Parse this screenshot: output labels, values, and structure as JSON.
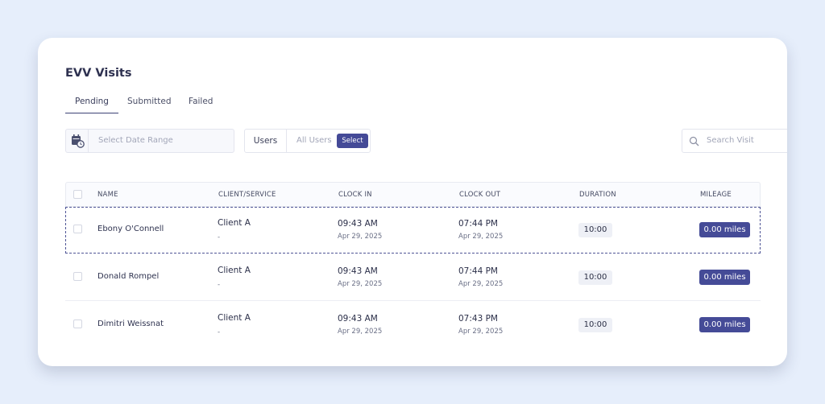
{
  "page": {
    "title": "EVV Visits"
  },
  "tabs": [
    {
      "label": "Pending",
      "active": true
    },
    {
      "label": "Submitted",
      "active": false
    },
    {
      "label": "Failed",
      "active": false
    }
  ],
  "filters": {
    "date_icon": "calendar-clock-icon",
    "date_placeholder": "Select Date Range",
    "users_label": "Users",
    "users_value": "All Users",
    "select_label": "Select",
    "search_icon": "search-icon",
    "search_placeholder": "Search Visit"
  },
  "table": {
    "columns": [
      "NAME",
      "CLIENT/SERVICE",
      "CLOCK IN",
      "CLOCK OUT",
      "DURATION",
      "MILEAGE"
    ],
    "rows": [
      {
        "name": "Ebony O'Connell",
        "client": "Client A",
        "service": "-",
        "clock_in_time": "09:43 AM",
        "clock_in_date": "Apr 29, 2025",
        "clock_out_time": "07:44 PM",
        "clock_out_date": "Apr 29, 2025",
        "duration": "10:00",
        "mileage": "0.00 miles"
      },
      {
        "name": "Donald Rompel",
        "client": "Client A",
        "service": "-",
        "clock_in_time": "09:43 AM",
        "clock_in_date": "Apr 29, 2025",
        "clock_out_time": "07:44 PM",
        "clock_out_date": "Apr 29, 2025",
        "duration": "10:00",
        "mileage": "0.00 miles"
      },
      {
        "name": "Dimitri Weissnat",
        "client": "Client A",
        "service": "-",
        "clock_in_time": "09:43 AM",
        "clock_in_date": "Apr 29, 2025",
        "clock_out_time": "07:43 PM",
        "clock_out_date": "Apr 29, 2025",
        "duration": "10:00",
        "mileage": "0.00 miles"
      }
    ]
  },
  "colors": {
    "background": "#e6eefb",
    "accent": "#444a97",
    "card": "#ffffff"
  }
}
